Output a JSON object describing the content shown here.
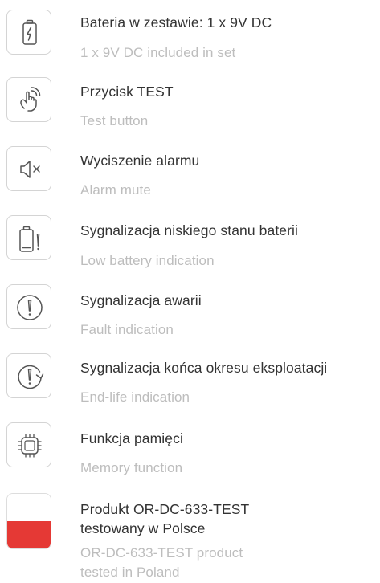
{
  "features": [
    {
      "icon": "battery-charge-icon",
      "title": "Bateria w zestawie: 1 x 9V DC",
      "subtitle": "1 x 9V DC included in set"
    },
    {
      "icon": "touch-button-icon",
      "title": "Przycisk TEST",
      "subtitle": "Test button"
    },
    {
      "icon": "speaker-mute-icon",
      "title": "Wyciszenie alarmu",
      "subtitle": "Alarm mute"
    },
    {
      "icon": "low-battery-icon",
      "title": "Sygnalizacja niskiego stanu baterii",
      "subtitle": "Low battery indication"
    },
    {
      "icon": "fault-icon",
      "title": "Sygnalizacja awarii",
      "subtitle": "Fault indication"
    },
    {
      "icon": "end-life-icon",
      "title": "Sygnalizacja końca okresu eksploatacji",
      "subtitle": "End-life indication"
    },
    {
      "icon": "memory-chip-icon",
      "title": "Funkcja pamięci",
      "subtitle": "Memory function"
    },
    {
      "icon": "poland-flag-icon",
      "title_line1": "Produkt OR-DC-633-TEST",
      "title_line2": "testowany w Polsce",
      "subtitle_line1": "OR-DC-633-TEST product",
      "subtitle_line2": "tested in Poland"
    }
  ],
  "colors": {
    "title": "#333333",
    "subtitle": "#bdbdbd",
    "icon_stroke": "#555555",
    "tile_border": "#d4d4d4",
    "flag_red": "#e53935"
  }
}
